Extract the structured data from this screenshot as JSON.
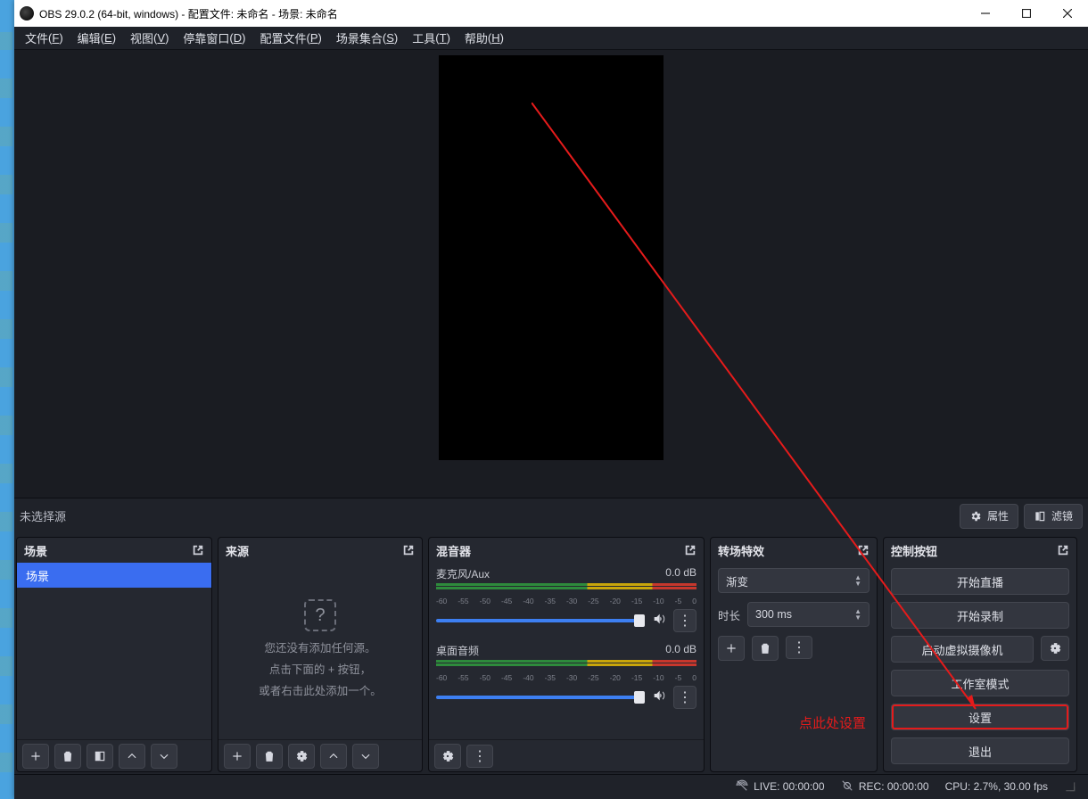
{
  "titlebar": {
    "icon": "obs-icon",
    "text": "OBS 29.0.2 (64-bit, windows) - 配置文件: 未命名 - 场景: 未命名"
  },
  "menubar": [
    {
      "label": "文件",
      "accel": "F"
    },
    {
      "label": "编辑",
      "accel": "E"
    },
    {
      "label": "视图",
      "accel": "V"
    },
    {
      "label": "停靠窗口",
      "accel": "D"
    },
    {
      "label": "配置文件",
      "accel": "P"
    },
    {
      "label": "场景集合",
      "accel": "S"
    },
    {
      "label": "工具",
      "accel": "T"
    },
    {
      "label": "帮助",
      "accel": "H"
    }
  ],
  "midbar": {
    "no_source": "未选择源",
    "properties": "属性",
    "filters": "滤镜"
  },
  "docks": {
    "scenes": {
      "title": "场景",
      "items": [
        "场景"
      ]
    },
    "sources": {
      "title": "来源",
      "empty": [
        "您还没有添加任何源。",
        "点击下面的 + 按钮，",
        "或者右击此处添加一个。"
      ]
    },
    "mixer": {
      "title": "混音器",
      "channels": [
        {
          "name": "麦克风/Aux",
          "db": "0.0 dB",
          "ticks": [
            "-60",
            "-55",
            "-50",
            "-45",
            "-40",
            "-35",
            "-30",
            "-25",
            "-20",
            "-15",
            "-10",
            "-5",
            "0"
          ]
        },
        {
          "name": "桌面音频",
          "db": "0.0 dB",
          "ticks": [
            "-60",
            "-55",
            "-50",
            "-45",
            "-40",
            "-35",
            "-30",
            "-25",
            "-20",
            "-15",
            "-10",
            "-5",
            "0"
          ]
        }
      ]
    },
    "transition": {
      "title": "转场特效",
      "type": "渐变",
      "duration_label": "时长",
      "duration_value": "300 ms"
    },
    "controls": {
      "title": "控制按钮",
      "buttons": {
        "stream": "开始直播",
        "record": "开始录制",
        "vcam": "启动虚拟摄像机",
        "studio": "工作室模式",
        "settings": "设置",
        "exit": "退出"
      }
    }
  },
  "statusbar": {
    "live_label": "LIVE:",
    "live_time": "00:00:00",
    "rec_label": "REC:",
    "rec_time": "00:00:00",
    "cpu": "CPU: 2.7%, 30.00 fps"
  },
  "annotation": "点此处设置"
}
